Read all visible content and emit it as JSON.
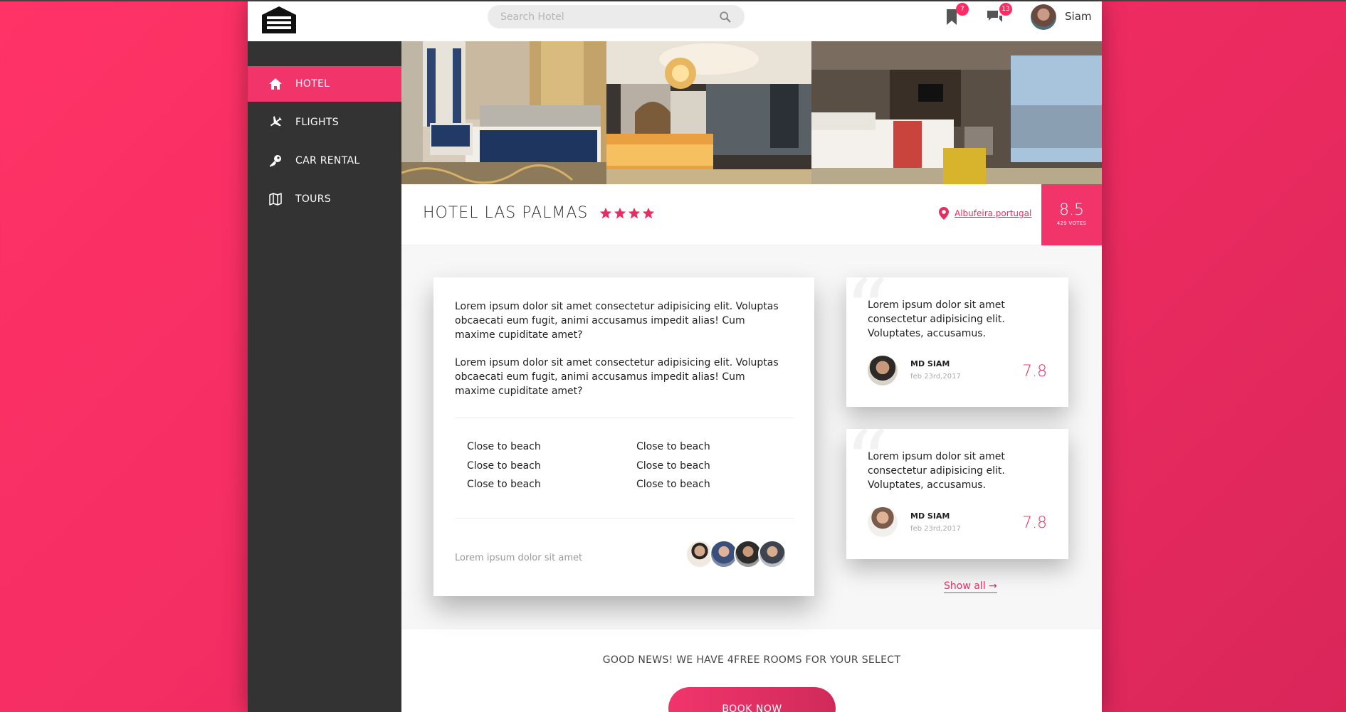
{
  "header": {
    "search_placeholder": "Search Hotel",
    "bookmark_badge": "7",
    "messages_badge": "13",
    "username": "Siam"
  },
  "sidebar": {
    "items": [
      {
        "label": "HOTEL",
        "icon": "home-icon",
        "active": true
      },
      {
        "label": "FLIGHTS",
        "icon": "airplane-icon",
        "active": false
      },
      {
        "label": "CAR RENTAL",
        "icon": "key-icon",
        "active": false
      },
      {
        "label": "TOURS",
        "icon": "map-icon",
        "active": false
      }
    ]
  },
  "hotel": {
    "name": "HOTEL LAS PALMAS",
    "stars": 4,
    "location": "Albufeira.portugal",
    "score": "8.5",
    "votes": "429 VOTES"
  },
  "description": {
    "para1": "Lorem ipsum dolor sit amet consectetur adipisicing elit. Voluptas obcaecati eum fugit, animi accusamus impedit alias! Cum maxime cupiditate amet?",
    "para2": "Lorem ipsum dolor sit amet consectetur adipisicing elit. Voluptas obcaecati eum fugit, animi accusamus impedit alias! Cum maxime cupiditate amet?",
    "features": [
      "Close to beach",
      "Close to beach",
      "Close to beach",
      "Close to beach",
      "Close to beach",
      "Close to beach"
    ],
    "footer_text": "Lorem ipsum dolor sit amet"
  },
  "reviews": [
    {
      "text": "Lorem ipsum dolor sit amet consectetur adipisicing elit. Voluptates, accusamus.",
      "name": "MD SIAM",
      "date": "feb 23rd,2017",
      "score": "7.8"
    },
    {
      "text": "Lorem ipsum dolor sit amet consectetur adipisicing elit. Voluptates, accusamus.",
      "name": "MD SIAM",
      "date": "feb 23rd,2017",
      "score": "7.8"
    }
  ],
  "show_all": "Show all  →",
  "promo": {
    "text": "GOOD NEWS! WE HAVE 4FREE ROOMS FOR YOUR SELECT",
    "button": "BOOK NOW"
  },
  "colors": {
    "accent": "#f1356b",
    "sidebar_bg": "#333333",
    "background": "#ff3366"
  }
}
